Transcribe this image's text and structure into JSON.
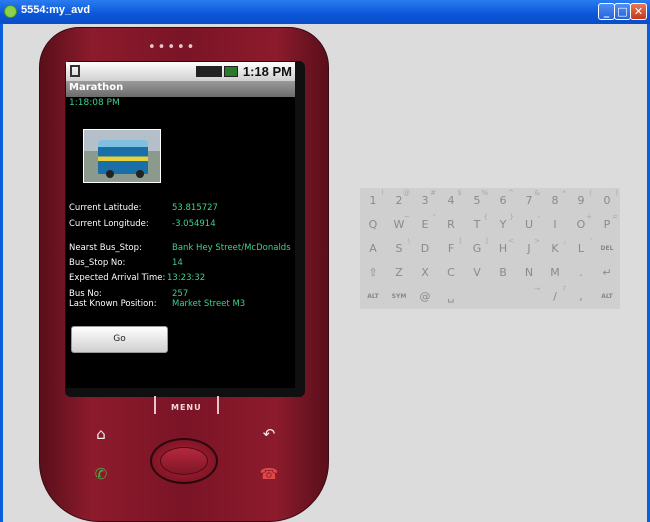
{
  "window": {
    "title": "5554:my_avd",
    "buttons": {
      "min": "_",
      "max": "□",
      "close": "✕"
    }
  },
  "phone": {
    "speaker": "•••••",
    "statusbar": {
      "time": "1:18 PM",
      "icons": [
        "sim-icon",
        "3g-icon",
        "signal-icon",
        "battery-icon"
      ]
    },
    "app_title": "Marathon",
    "clock_time": "1:18:08 PM",
    "fields": [
      {
        "label": "Current Latitude:",
        "value": "53.815727"
      },
      {
        "label": "Current Longitude:",
        "value": "-3.054914"
      },
      {
        "label": "Nearst Bus_Stop:",
        "value": "Bank Hey Street/McDonalds"
      },
      {
        "label": "Bus_Stop No:",
        "value": "14"
      },
      {
        "label": "Expected Arrival Time:",
        "value": "13:23:32"
      },
      {
        "label": "Bus No:",
        "value": "257"
      },
      {
        "label": "Last Known Position:",
        "value": "Market Street M3"
      }
    ],
    "go_button": "Go",
    "menu_label": "MENU",
    "nav_icons": {
      "home": "⌂",
      "back": "↶",
      "call": "✆",
      "endcall": "☎"
    }
  },
  "keyboard": {
    "row1": [
      "1",
      "2",
      "3",
      "4",
      "5",
      "6",
      "7",
      "8",
      "9",
      "0"
    ],
    "row1_sup": [
      "!",
      "@",
      "#",
      "$",
      "%",
      "^",
      "&",
      "*",
      "(",
      ")"
    ],
    "row2": [
      "Q",
      "W",
      "E",
      "R",
      "T",
      "Y",
      "U",
      "I",
      "O",
      "P"
    ],
    "row2_sup": [
      "",
      "~",
      "\"",
      "",
      "{",
      "}",
      "-",
      "",
      "+",
      "="
    ],
    "row3": [
      "A",
      "S",
      "D",
      "F",
      "G",
      "H",
      "J",
      "K",
      "L",
      "DEL"
    ],
    "row3_sup": [
      "",
      "\\",
      "",
      "[",
      "]",
      "<",
      ">",
      ";",
      "'",
      ""
    ],
    "row4": [
      "⇧",
      "Z",
      "X",
      "C",
      "V",
      "B",
      "N",
      "M",
      ".",
      "↵"
    ],
    "row4_sup": [
      "",
      "",
      "",
      "",
      "",
      "",
      "",
      "",
      "",
      ""
    ],
    "row5": [
      "ALT",
      "SYM",
      "@",
      "␣",
      "",
      "",
      "",
      "/",
      ",",
      "ALT"
    ],
    "row5_sup": [
      "",
      "",
      "",
      "",
      "",
      "",
      "→",
      "?",
      "",
      ""
    ]
  },
  "colors": {
    "phone_body": "#7a1426",
    "screen_bg": "#000000",
    "value_text": "#40d08c",
    "titlebar": "#0a55d8"
  }
}
